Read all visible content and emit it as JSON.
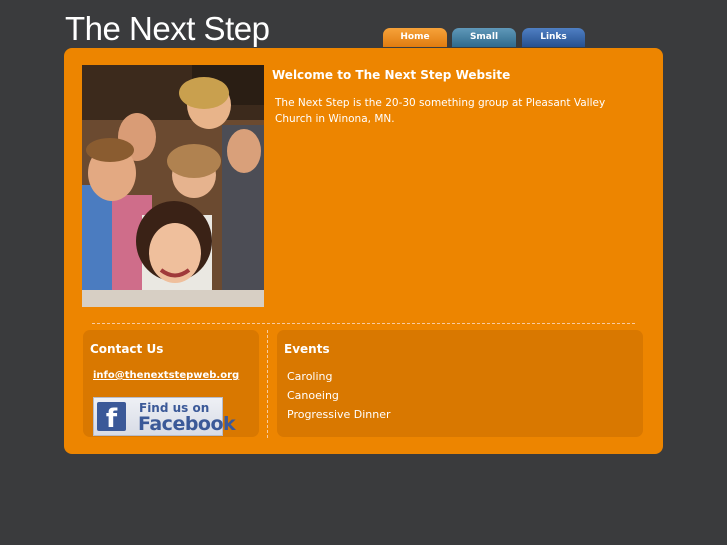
{
  "site": {
    "title": "The Next Step"
  },
  "nav": {
    "items": [
      {
        "label": "Home"
      },
      {
        "label": "Small Groups"
      },
      {
        "label": "Links"
      }
    ]
  },
  "welcome": {
    "title": "Welcome to The Next Step Website",
    "text": "The Next Step is the 20-30 something group at Pleasant Valley Church in Winona, MN."
  },
  "contact": {
    "title": "Contact Us",
    "email": "info@thenextstepweb.org",
    "facebook_line1": "Find us on",
    "facebook_line2": "Facebook",
    "facebook_logo": "f"
  },
  "events": {
    "title": "Events",
    "items": [
      "Caroling",
      "Canoeing",
      "Progressive Dinner"
    ]
  },
  "colors": {
    "background": "#3a3b3d",
    "panel": "#ed8500",
    "panel_box": "#d97800",
    "facebook_blue": "#3b5998"
  }
}
